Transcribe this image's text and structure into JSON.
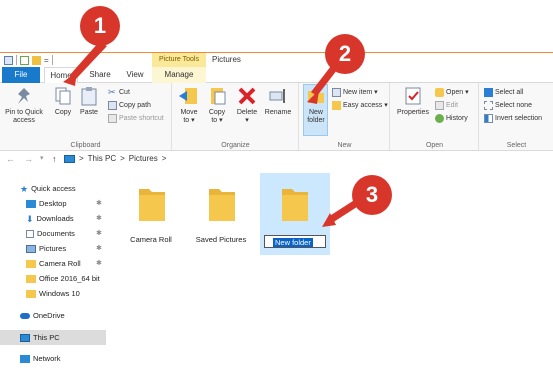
{
  "window": {
    "title": "Pictures",
    "contextual_group": "Picture Tools"
  },
  "tabs": [
    {
      "label": "File"
    },
    {
      "label": "Home"
    },
    {
      "label": "Share"
    },
    {
      "label": "View"
    },
    {
      "label": "Manage"
    }
  ],
  "ribbon": {
    "clipboard": {
      "label": "Clipboard",
      "pin": "Pin to Quick access",
      "copy": "Copy",
      "paste": "Paste",
      "cut": "Cut",
      "copy_path": "Copy path",
      "paste_shortcut": "Paste shortcut"
    },
    "organize": {
      "label": "Organize",
      "move_to": "Move to",
      "copy_to": "Copy to",
      "delete": "Delete",
      "rename": "Rename"
    },
    "new": {
      "label": "New",
      "new_folder": "New folder",
      "new_item": "New item",
      "easy_access": "Easy access"
    },
    "open": {
      "label": "Open",
      "properties": "Properties",
      "open": "Open",
      "edit": "Edit",
      "history": "History"
    },
    "select": {
      "label": "Select",
      "select_all": "Select all",
      "select_none": "Select none",
      "invert": "Invert selection"
    }
  },
  "address": {
    "crumbs": [
      "This PC",
      "Pictures"
    ],
    "sep": ">"
  },
  "navpane": {
    "items": [
      {
        "label": "Quick access",
        "icon": "star-icon"
      },
      {
        "label": "Desktop",
        "icon": "desktop-icon",
        "pinned": true
      },
      {
        "label": "Downloads",
        "icon": "download-icon",
        "pinned": true
      },
      {
        "label": "Documents",
        "icon": "document-icon",
        "pinned": true
      },
      {
        "label": "Pictures",
        "icon": "pictures-icon",
        "pinned": true
      },
      {
        "label": "Camera Roll",
        "icon": "folder-icon",
        "pinned": true
      },
      {
        "label": "Office 2016_64 bit",
        "icon": "folder-icon"
      },
      {
        "label": "Windows 10",
        "icon": "folder-icon"
      },
      {
        "label": "OneDrive",
        "icon": "cloud-icon"
      },
      {
        "label": "This PC",
        "icon": "computer-icon",
        "selected": true
      },
      {
        "label": "Network",
        "icon": "network-icon"
      }
    ]
  },
  "folders": [
    {
      "label": "Camera Roll"
    },
    {
      "label": "Saved Pictures"
    },
    {
      "label": "",
      "rename_value": "New folder",
      "selected": true
    }
  ],
  "callouts": [
    "1",
    "2",
    "3"
  ],
  "colors": {
    "callout": "#d9362b",
    "file_tab": "#1979ca",
    "selection": "#cce8ff",
    "folder": "#f5c74d"
  }
}
